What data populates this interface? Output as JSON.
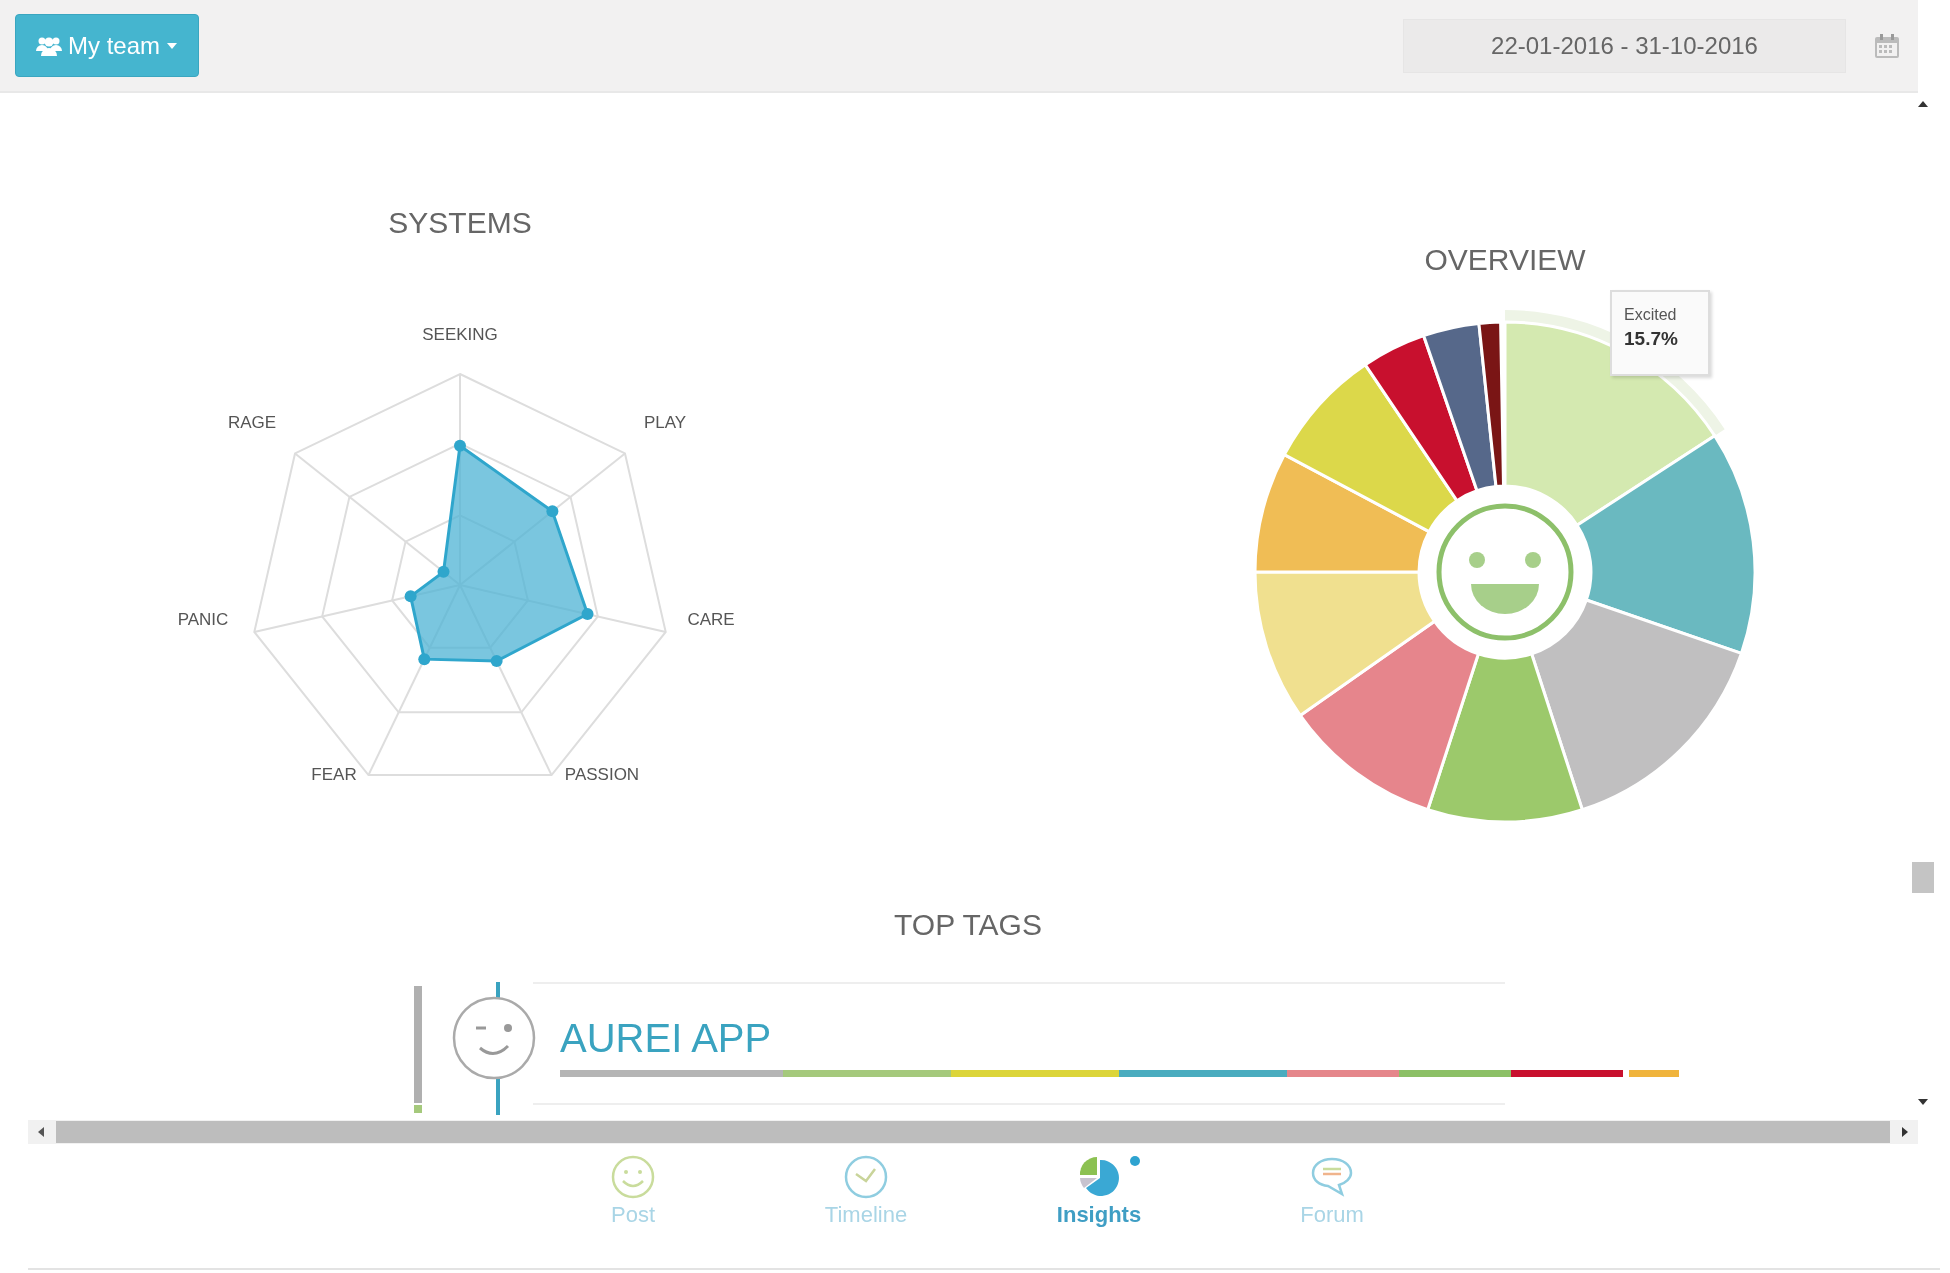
{
  "toolbar": {
    "team_button": {
      "label": "My team"
    },
    "date_range": {
      "value": "22-01-2016 - 31-10-2016"
    }
  },
  "systems": {
    "title": "SYSTEMS",
    "axes": [
      "SEEKING",
      "PLAY",
      "CARE",
      "PASSION",
      "FEAR",
      "PANIC",
      "RAGE"
    ]
  },
  "overview": {
    "title": "OVERVIEW",
    "tooltip": {
      "label": "Excited",
      "value": "15.7%"
    }
  },
  "top_tags": {
    "title": "TOP TAGS",
    "tags": [
      {
        "name": "AUREI APP"
      }
    ]
  },
  "nav": [
    {
      "label": "Post",
      "kind": "smiley",
      "selected": false,
      "dot": false
    },
    {
      "label": "Timeline",
      "kind": "clock",
      "selected": false,
      "dot": false
    },
    {
      "label": "Insights",
      "kind": "pie",
      "selected": true,
      "dot": true
    },
    {
      "label": "Forum",
      "kind": "bubble",
      "selected": false,
      "dot": false
    }
  ]
}
